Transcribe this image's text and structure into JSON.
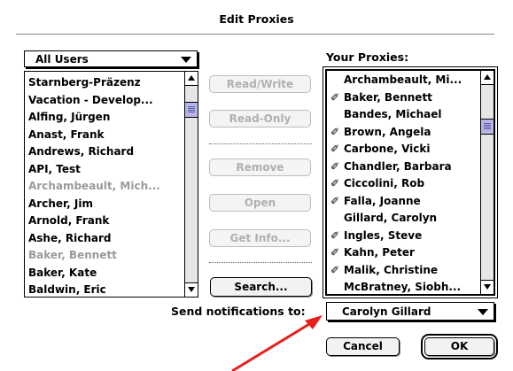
{
  "dialog": {
    "title": "Edit Proxies"
  },
  "users_popup": {
    "selected": "All Users"
  },
  "user_list": {
    "items": [
      {
        "label": "Starnberg-Präzenz",
        "dim": false
      },
      {
        "label": "Vacation - Develop...",
        "dim": false
      },
      {
        "label": "Alfing, Jürgen",
        "dim": false
      },
      {
        "label": "Anast, Frank",
        "dim": false
      },
      {
        "label": "Andrews, Richard",
        "dim": false
      },
      {
        "label": "API, Test",
        "dim": false
      },
      {
        "label": "Archambeault, Mich...",
        "dim": true
      },
      {
        "label": "Archer, Jim",
        "dim": false
      },
      {
        "label": "Arnold, Frank",
        "dim": false
      },
      {
        "label": "Ashe, Richard",
        "dim": false
      },
      {
        "label": "Baker, Bennett",
        "dim": true
      },
      {
        "label": "Baker, Kate",
        "dim": false
      },
      {
        "label": "Baldwin, Eric",
        "dim": false
      }
    ]
  },
  "actions": {
    "read_write": "Read/Write",
    "read_only": "Read-Only",
    "remove": "Remove",
    "open": "Open",
    "get_info": "Get Info...",
    "search": "Search..."
  },
  "proxies": {
    "heading": "Your Proxies:",
    "items": [
      {
        "label": "Archambeault, Mi...",
        "marked": false
      },
      {
        "label": "Baker, Bennett",
        "marked": true
      },
      {
        "label": "Bandes, Michael",
        "marked": false
      },
      {
        "label": "Brown, Angela",
        "marked": true
      },
      {
        "label": "Carbone, Vicki",
        "marked": true
      },
      {
        "label": "Chandler, Barbara",
        "marked": true
      },
      {
        "label": "Ciccolini, Rob",
        "marked": true
      },
      {
        "label": "Falla, Joanne",
        "marked": true
      },
      {
        "label": "Gillard, Carolyn",
        "marked": false
      },
      {
        "label": "Ingles, Steve",
        "marked": true
      },
      {
        "label": "Kahn, Peter",
        "marked": true
      },
      {
        "label": "Malik, Christine",
        "marked": true
      },
      {
        "label": "McBratney, Siobh...",
        "marked": false
      }
    ]
  },
  "notifications": {
    "label": "Send notifications to:",
    "selected": "Carolyn Gillard"
  },
  "footer": {
    "cancel": "Cancel",
    "ok": "OK"
  },
  "colors": {
    "annotation_arrow": "#e8201c",
    "scroll_thumb": "#b8b6e6"
  },
  "icons": {
    "proxy_mark": "pencil-icon"
  }
}
